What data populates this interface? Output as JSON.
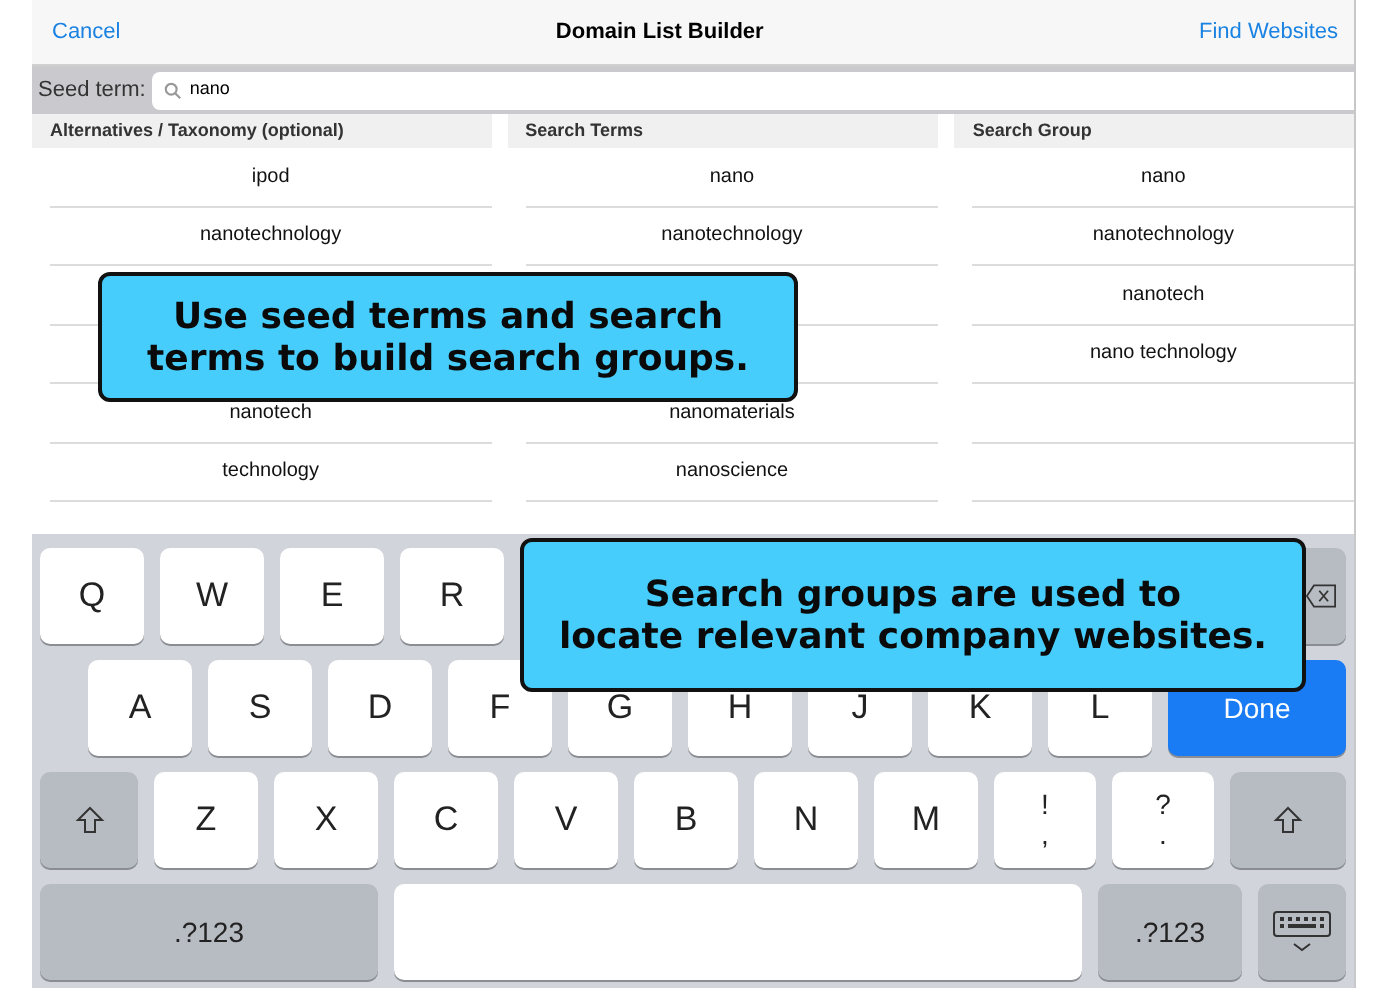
{
  "nav": {
    "cancel": "Cancel",
    "title": "Domain List Builder",
    "action": "Find Websites"
  },
  "seed": {
    "label": "Seed term:",
    "value": "nano"
  },
  "table": {
    "columns": [
      {
        "header": "Alternatives / Taxonomy (optional)",
        "cells": [
          "ipod",
          "nanotechnology",
          null,
          null,
          "nanotech",
          "technology"
        ]
      },
      {
        "header": "Search Terms",
        "cells": [
          "nano",
          "nanotechnology",
          null,
          null,
          "nanomaterials",
          "nanoscience"
        ]
      },
      {
        "header": "Search Group",
        "cells": [
          "nano",
          "nanotechnology",
          "nanotech",
          "nano technology",
          null,
          null
        ]
      }
    ]
  },
  "keyboard": {
    "rows": [
      {
        "keys": [
          {
            "kind": "letter",
            "label": "Q"
          },
          {
            "kind": "letter",
            "label": "W"
          },
          {
            "kind": "letter",
            "label": "E"
          },
          {
            "kind": "letter",
            "label": "R"
          },
          {
            "kind": "backspace"
          }
        ]
      },
      {
        "keys": [
          {
            "kind": "letter",
            "label": "A"
          },
          {
            "kind": "letter",
            "label": "S"
          },
          {
            "kind": "letter",
            "label": "D"
          },
          {
            "kind": "letter",
            "label": "F"
          },
          {
            "kind": "letter",
            "label": "G"
          },
          {
            "kind": "letter",
            "label": "H"
          },
          {
            "kind": "letter",
            "label": "J"
          },
          {
            "kind": "letter",
            "label": "K"
          },
          {
            "kind": "letter",
            "label": "L"
          },
          {
            "kind": "done",
            "label": "Done"
          }
        ]
      },
      {
        "keys": [
          {
            "kind": "shift"
          },
          {
            "kind": "letter",
            "label": "Z"
          },
          {
            "kind": "letter",
            "label": "X"
          },
          {
            "kind": "letter",
            "label": "C"
          },
          {
            "kind": "letter",
            "label": "V"
          },
          {
            "kind": "letter",
            "label": "B"
          },
          {
            "kind": "letter",
            "label": "N"
          },
          {
            "kind": "letter",
            "label": "M"
          },
          {
            "kind": "punct",
            "label": "!",
            "secondary": ","
          },
          {
            "kind": "punct",
            "label": "?",
            "secondary": "."
          },
          {
            "kind": "shift"
          }
        ]
      },
      {
        "keys": [
          {
            "kind": "mode",
            "label": ".?123"
          },
          {
            "kind": "space"
          },
          {
            "kind": "mode",
            "label": ".?123"
          },
          {
            "kind": "dismiss"
          }
        ]
      }
    ]
  },
  "callouts": [
    {
      "lines": [
        "Use seed terms and search",
        "terms to build search groups."
      ]
    },
    {
      "lines": [
        "Search groups are used to",
        "locate relevant company websites."
      ]
    }
  ]
}
